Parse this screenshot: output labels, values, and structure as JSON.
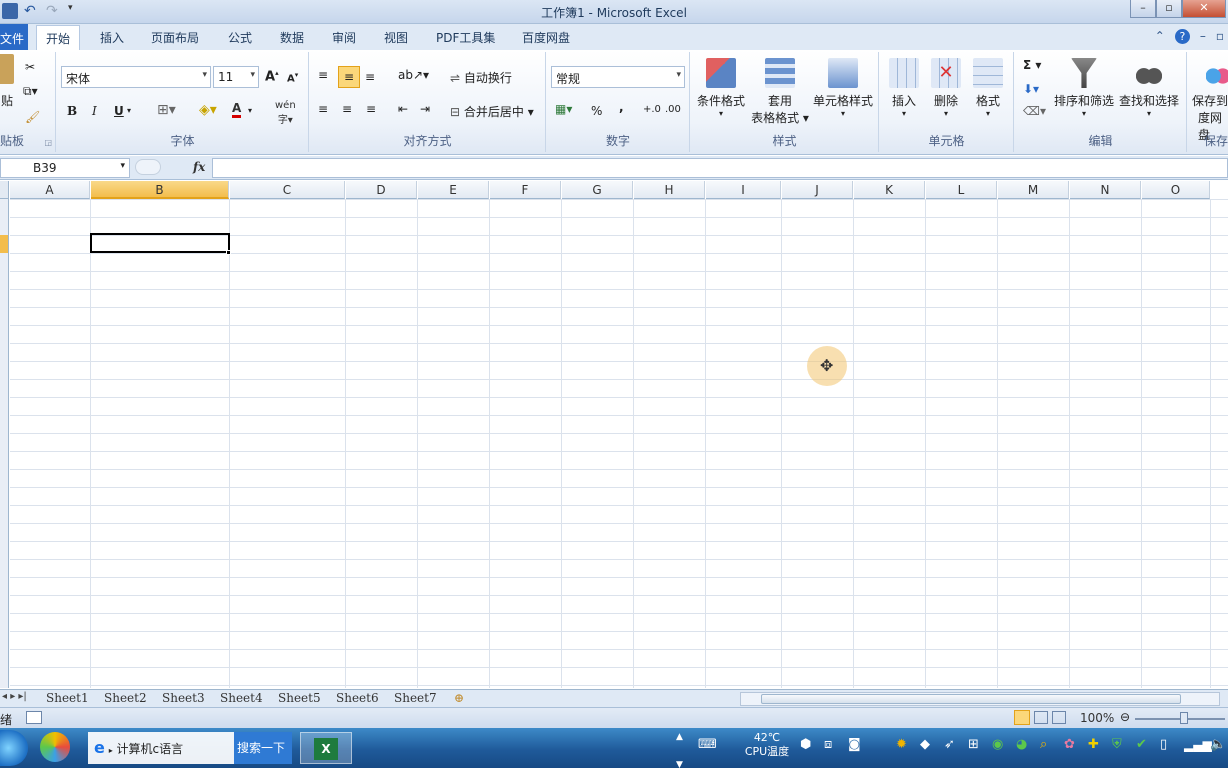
{
  "window": {
    "title": "工作簿1 - Microsoft Excel"
  },
  "tabs": [
    "文件",
    "开始",
    "插入",
    "页面布局",
    "公式",
    "数据",
    "审阅",
    "视图",
    "PDF工具集",
    "百度网盘"
  ],
  "ribbon": {
    "clipboard": {
      "paste": "贴",
      "label": "贴板"
    },
    "font": {
      "name": "宋体",
      "size": "11",
      "label": "字体",
      "bold": "B",
      "italic": "I",
      "underline": "U",
      "grow": "A",
      "shrink": "A",
      "color_letter": "A",
      "wen": "wén"
    },
    "align": {
      "wrap": "自动换行",
      "merge": "合并后居中",
      "label": "对齐方式"
    },
    "number": {
      "format": "常规",
      "percent": "%",
      "comma": ",",
      "label": "数字"
    },
    "styles": {
      "conditional": "条件格式",
      "table1": "套用",
      "table2": "表格格式",
      "cell_style": "单元格样式",
      "label": "样式"
    },
    "cells": {
      "insert": "插入",
      "delete": "删除",
      "format": "格式",
      "label": "单元格"
    },
    "editing": {
      "sum": "Σ",
      "sort": "排序和筛选",
      "find": "查找和选择",
      "label": "编辑"
    },
    "save": {
      "line1": "保存到",
      "line2": "度网盘",
      "label": "保存"
    }
  },
  "formula_bar": {
    "namebox": "B39",
    "fx": "fx",
    "value": ""
  },
  "columns": [
    "A",
    "B",
    "C",
    "D",
    "E",
    "F",
    "G",
    "H",
    "I",
    "J",
    "K",
    "L",
    "M",
    "N",
    "O"
  ],
  "selected_cell": "B39",
  "sheets": [
    "Sheet1",
    "Sheet2",
    "Sheet3",
    "Sheet4",
    "Sheet5",
    "Sheet6",
    "Sheet7"
  ],
  "status": {
    "ready": "绪",
    "zoom": "100%"
  },
  "taskbar": {
    "ie_item": "计算机c语言",
    "search": "搜索一下",
    "temp": "42℃",
    "cpu": "CPU温度"
  }
}
